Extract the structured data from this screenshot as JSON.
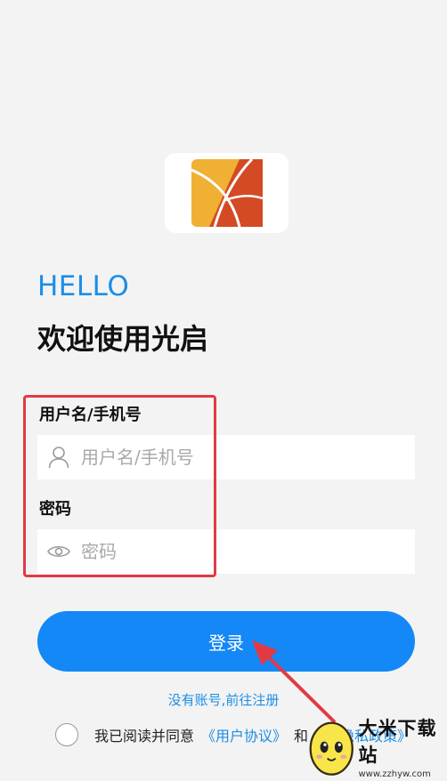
{
  "greeting": "HELLO",
  "welcome_title": "欢迎使用光启",
  "username": {
    "label": "用户名/手机号",
    "placeholder": "用户名/手机号",
    "value": "",
    "icon": "user-icon"
  },
  "password": {
    "label": "密码",
    "placeholder": "密码",
    "value": "",
    "icon": "eye-icon"
  },
  "login_button": "登录",
  "register_link": "没有账号,前往注册",
  "agreement": {
    "prefix": "我已阅读并同意",
    "user_agreement": "《用户协议》",
    "conjunction": "和",
    "privacy_policy": "《隐私政策》",
    "checked": false
  },
  "watermark": {
    "name": "大米下载站",
    "url": "www.zzhyw.com"
  },
  "colors": {
    "accent": "#1388f6",
    "highlight": "#e23a45",
    "logo_orange": "#f0b034",
    "logo_red": "#d44a24"
  }
}
